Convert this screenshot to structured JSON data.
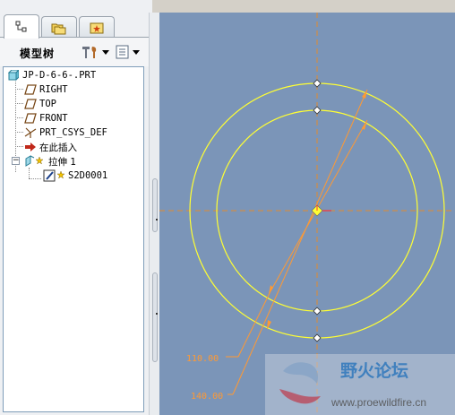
{
  "tabs": [
    {
      "name": "model-tree",
      "icon": "model-tree-icon"
    },
    {
      "name": "folder-browser",
      "icon": "folders-icon"
    },
    {
      "name": "favorites",
      "icon": "favorites-icon"
    }
  ],
  "toolbar": {
    "title": "模型树",
    "settings_icon": "tools-icon",
    "show_icon": "list-icon"
  },
  "tree": {
    "items": [
      {
        "label": "JP-D-6-6-.PRT",
        "icon": "part-icon"
      },
      {
        "label": "RIGHT",
        "icon": "datum-plane-icon"
      },
      {
        "label": "TOP",
        "icon": "datum-plane-icon"
      },
      {
        "label": "FRONT",
        "icon": "datum-plane-icon"
      },
      {
        "label": "PRT_CSYS_DEF",
        "icon": "csys-icon"
      },
      {
        "label": "在此插入",
        "icon": "insert-arrow-icon"
      },
      {
        "label": "拉伸 1",
        "icon": "extrude-icon"
      },
      {
        "label": "S2D0001",
        "icon": "sketch-icon"
      }
    ]
  },
  "sketch": {
    "dim_outer": "140.00",
    "dim_inner": "110.00",
    "line_color": "#ffff33",
    "dim_color": "#ff9933",
    "center_mark_color": "#ff3333"
  },
  "watermark": {
    "title": "野火论坛",
    "url": "www.proewildfire.cn"
  }
}
